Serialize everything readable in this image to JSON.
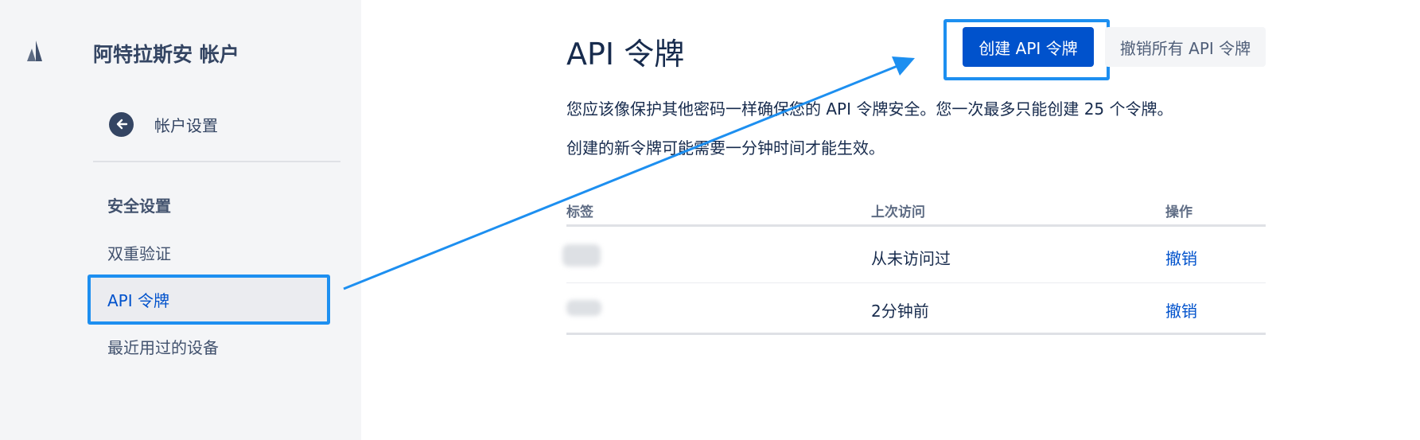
{
  "sidebar": {
    "brand": "阿特拉斯安 帐户",
    "back_label": "帐户设置",
    "section_title": "安全设置",
    "items": [
      {
        "label": "双重验证"
      },
      {
        "label": "API 令牌"
      },
      {
        "label": "最近用过的设备"
      }
    ]
  },
  "main": {
    "title": "API 令牌",
    "create_button": "创建 API 令牌",
    "revoke_all_button": "撤销所有 API 令牌",
    "desc_line1": "您应该像保护其他密码一样确保您的 API 令牌安全。您一次最多只能创建 25 个令牌。",
    "desc_line2": "创建的新令牌可能需要一分钟时间才能生效。",
    "table": {
      "headers": [
        "标签",
        "上次访问",
        "操作"
      ],
      "rows": [
        {
          "label": "",
          "last_access": "从未访问过",
          "action": "撤销"
        },
        {
          "label": "",
          "last_access": "2分钟前",
          "action": "撤销"
        }
      ]
    }
  },
  "colors": {
    "primary": "#0052cc",
    "annotation": "#1d8ff0",
    "sidebar_bg": "#f4f5f7"
  }
}
